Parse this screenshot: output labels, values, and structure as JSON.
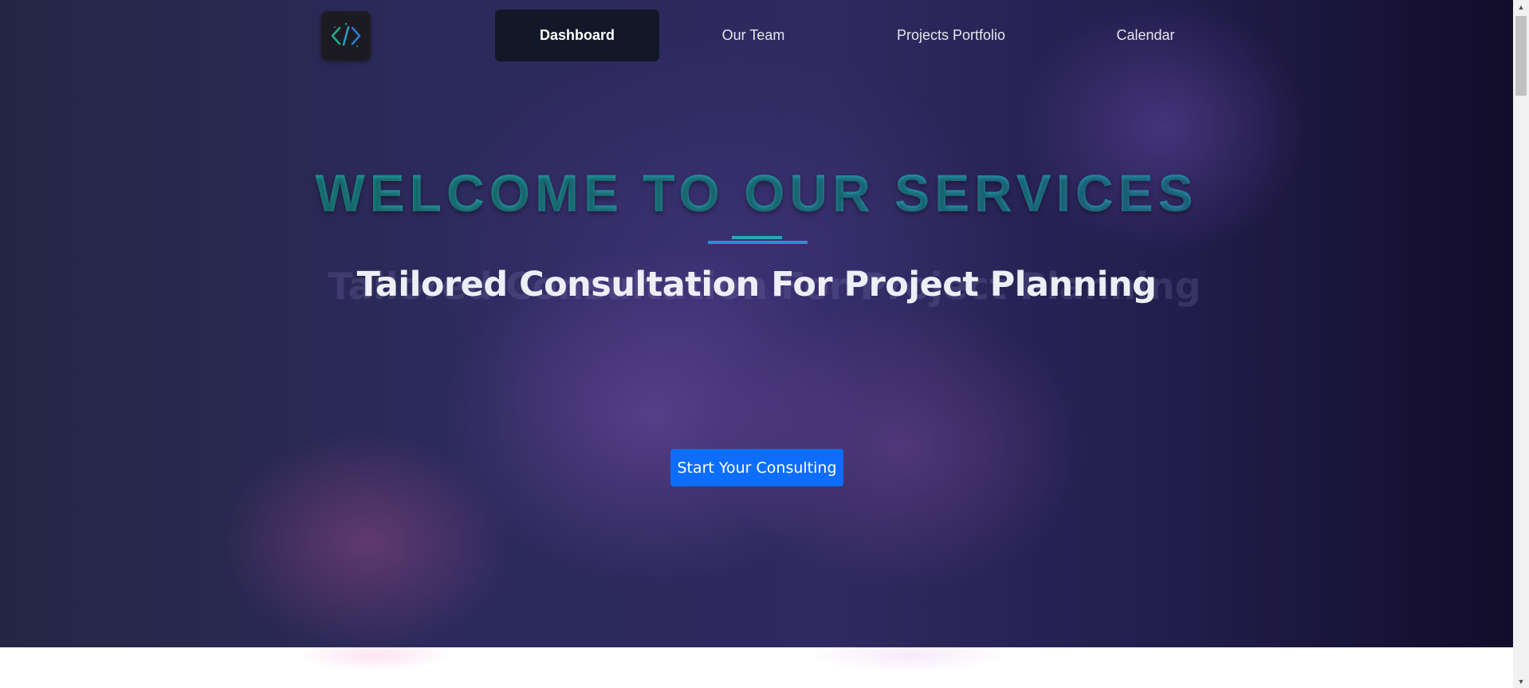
{
  "nav": {
    "logo_icon": "code-brackets-icon",
    "items": [
      {
        "label": "Dashboard",
        "active": true
      },
      {
        "label": "Our Team",
        "active": false
      },
      {
        "label": "Projects Portfolio",
        "active": false
      },
      {
        "label": "Calendar",
        "active": false
      }
    ]
  },
  "hero": {
    "title": "WELCOME TO OUR SERVICES",
    "subtitle": "Tailored Consultation For Project Planning",
    "cta_label": "Start Your Consulting"
  },
  "colors": {
    "title_teal": "#2a9aa1",
    "underline_blue": "#2a8fd0",
    "nav_active_bg": "#121828",
    "cta_blue": "#0d6efd"
  },
  "scrollbar": {
    "up_icon": "scroll-up-arrow-icon",
    "down_icon": "scroll-down-arrow-icon"
  }
}
